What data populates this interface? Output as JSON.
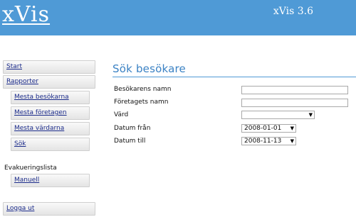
{
  "header": {
    "logo": "xVis",
    "version": "xVis 3.6"
  },
  "sidebar": {
    "start": "Start",
    "rapporter": "Rapporter",
    "sub_items": [
      "Mesta besökarna",
      "Mesta företagen",
      "Mesta värdarna",
      "Sök"
    ],
    "section_label": "Evakueringslista",
    "manuell": "Manuell",
    "logout": "Logga ut"
  },
  "main": {
    "title": "Sök besökare",
    "fields": {
      "visitor_name_label": "Besökarens namn",
      "company_name_label": "Företagets namn",
      "host_label": "Värd",
      "date_from_label": "Datum från",
      "date_to_label": "Datum till",
      "visitor_name_value": "",
      "company_name_value": "",
      "host_value": "",
      "date_from_value": "2008-01-01",
      "date_to_value": "2008-11-13"
    }
  },
  "colors": {
    "header": "#4f9ad6",
    "title": "#3b82c4",
    "link": "#1a2a8a"
  },
  "icons": {
    "dropdown": "chevron-down-icon"
  }
}
